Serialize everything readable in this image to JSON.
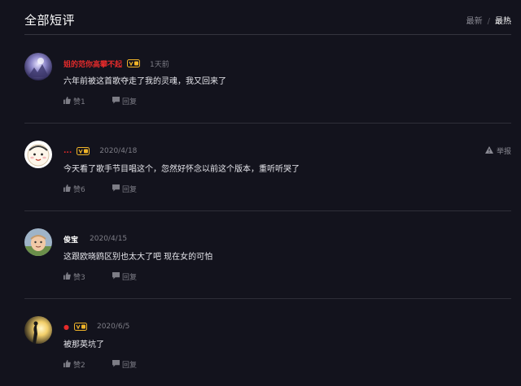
{
  "header": {
    "title": "全部短评",
    "sort_latest": "最新",
    "sort_separator": "/",
    "sort_hot": "最热"
  },
  "comments": [
    {
      "username": "姐的范你高攀不起",
      "date": "1天前",
      "content": "六年前被这首歌夺走了我的灵魂，我又回来了",
      "likes": "赞1",
      "reply": "回复"
    },
    {
      "username": "...",
      "date": "2020/4/18",
      "content": "今天看了歌手节目唱这个，忽然好怀念以前这个版本，重听听哭了",
      "likes": "赞6",
      "reply": "回复",
      "report": "举报"
    },
    {
      "username": "俊宝",
      "date": "2020/4/15",
      "content": "这跟欧晓鸥区别也太大了吧 现在女的可怕",
      "likes": "赞3",
      "reply": "回复"
    },
    {
      "username": "●",
      "date": "2020/6/5",
      "content": "被那英坑了",
      "likes": "赞2",
      "reply": "回复"
    }
  ],
  "icons": {
    "like": "thumbs-up-icon",
    "reply": "speech-bubble-icon",
    "report": "warning-icon",
    "vip": "vip-badge-icon"
  },
  "colors": {
    "background": "#13131d",
    "accent_red": "#e52b2b",
    "vip_gold": "#f0b429"
  }
}
